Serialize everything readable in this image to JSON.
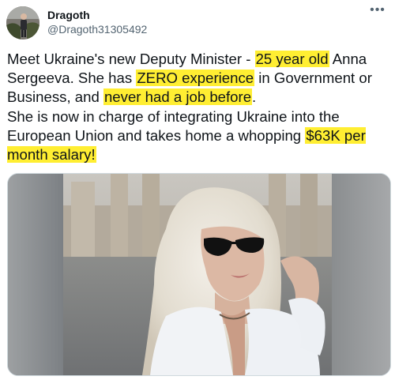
{
  "tweet": {
    "display_name": "Dragoth",
    "handle": "@Dragoth31305492",
    "more_icon": "more-horizontal-icon",
    "text_parts": [
      {
        "text": "Meet Ukraine's new Deputy Minister - ",
        "highlight": false
      },
      {
        "text": "25 year old",
        "highlight": true
      },
      {
        "text": " Anna Sergeeva. She has ",
        "highlight": false
      },
      {
        "text": "ZERO experience",
        "highlight": true
      },
      {
        "text": " in Government or Business, and ",
        "highlight": false
      },
      {
        "text": "never had a job before",
        "highlight": true
      },
      {
        "text": ".",
        "highlight": false
      },
      {
        "text": "She is now in charge of integrating Ukraine into the European Union and takes home a whopping ",
        "highlight": false
      },
      {
        "text": "$63K per month salary!",
        "highlight": true
      }
    ],
    "highlight_color": "#ffee32"
  }
}
